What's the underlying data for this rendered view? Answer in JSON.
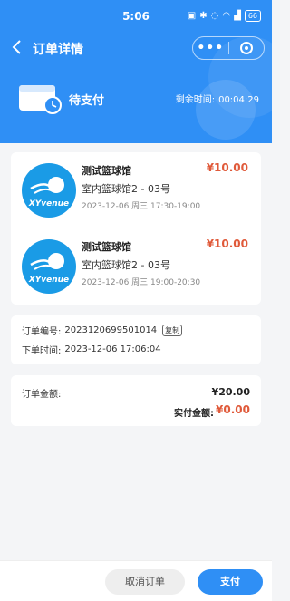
{
  "status_bar": {
    "time": "5:06",
    "battery": "66"
  },
  "nav": {
    "title": "订单详情"
  },
  "header": {
    "status": "待支付",
    "countdown_label": "剩余时间:",
    "countdown_value": "00:04:29"
  },
  "orders": [
    {
      "logo_text": "XYvenue",
      "venue": "测试篮球馆",
      "price": "¥10.00",
      "court": "室内篮球馆2 - 03号",
      "slot": "2023-12-06 周三 17:30-19:00"
    },
    {
      "logo_text": "XYvenue",
      "venue": "测试篮球馆",
      "price": "¥10.00",
      "court": "室内篮球馆2 - 03号",
      "slot": "2023-12-06 周三 19:00-20:30"
    }
  ],
  "info": {
    "order_no_label": "订单编号:",
    "order_no": "2023120699501014",
    "copy_label": "复制",
    "order_time_label": "下单时间:",
    "order_time": "2023-12-06 17:06:04"
  },
  "amount": {
    "label": "订单金额:",
    "total": "¥20.00",
    "paid_label": "实付金额:",
    "paid": "¥0.00"
  },
  "actions": {
    "cancel": "取消订单",
    "pay": "支付"
  },
  "colors": {
    "primary": "#2f8ff5",
    "price": "#e05a3a"
  }
}
